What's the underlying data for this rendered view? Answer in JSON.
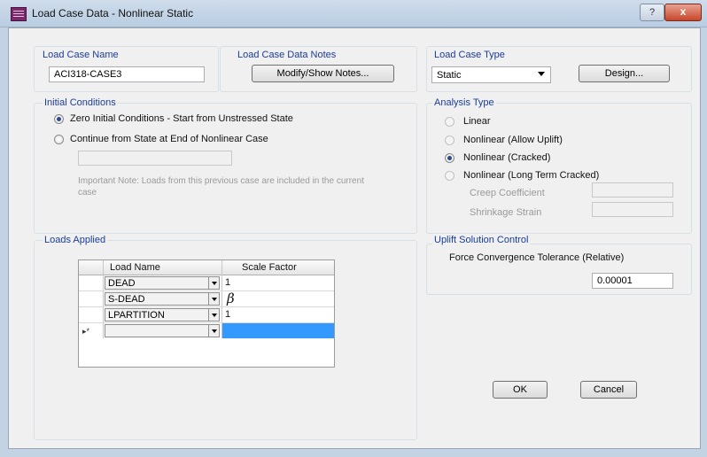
{
  "window": {
    "title": "Load Case Data - Nonlinear Static",
    "help": "?",
    "close": "x"
  },
  "name": {
    "label": "Load Case Name",
    "value": "ACI318-CASE3"
  },
  "notes": {
    "label": "Load Case Data Notes",
    "button": "Modify/Show Notes..."
  },
  "type": {
    "label": "Load Case Type",
    "value": "Static",
    "design_button": "Design..."
  },
  "initial": {
    "label": "Initial Conditions",
    "opt_zero": "Zero Initial Conditions - Start from Unstressed State",
    "opt_continue": "Continue from State at End of Nonlinear Case",
    "case_value": "",
    "note": "Important Note:  Loads from this previous case are included in the current case",
    "selected": "zero"
  },
  "analysis": {
    "label": "Analysis Type",
    "opt_linear": "Linear",
    "opt_uplift": "Nonlinear (Allow Uplift)",
    "opt_cracked": "Nonlinear (Cracked)",
    "opt_longterm": "Nonlinear (Long Term Cracked)",
    "creep_label": "Creep Coefficient",
    "creep_value": "",
    "shrink_label": "Shrinkage Strain",
    "shrink_value": "",
    "selected": "cracked"
  },
  "loads": {
    "label": "Loads Applied",
    "col_name": "Load Name",
    "col_scale": "Scale Factor",
    "rows": [
      {
        "name": "DEAD",
        "scale": "1"
      },
      {
        "name": "S-DEAD",
        "scale": "β"
      },
      {
        "name": "LPARTITION",
        "scale": "1"
      }
    ],
    "new_row_marker": "▸*"
  },
  "uplift": {
    "label": "Uplift Solution Control",
    "tol_label": "Force Convergence Tolerance (Relative)",
    "tol_value": "0.00001"
  },
  "buttons": {
    "ok": "OK",
    "cancel": "Cancel"
  },
  "colors": {
    "accent_blue": "#1a3c9a",
    "selection": "#3399ff"
  }
}
